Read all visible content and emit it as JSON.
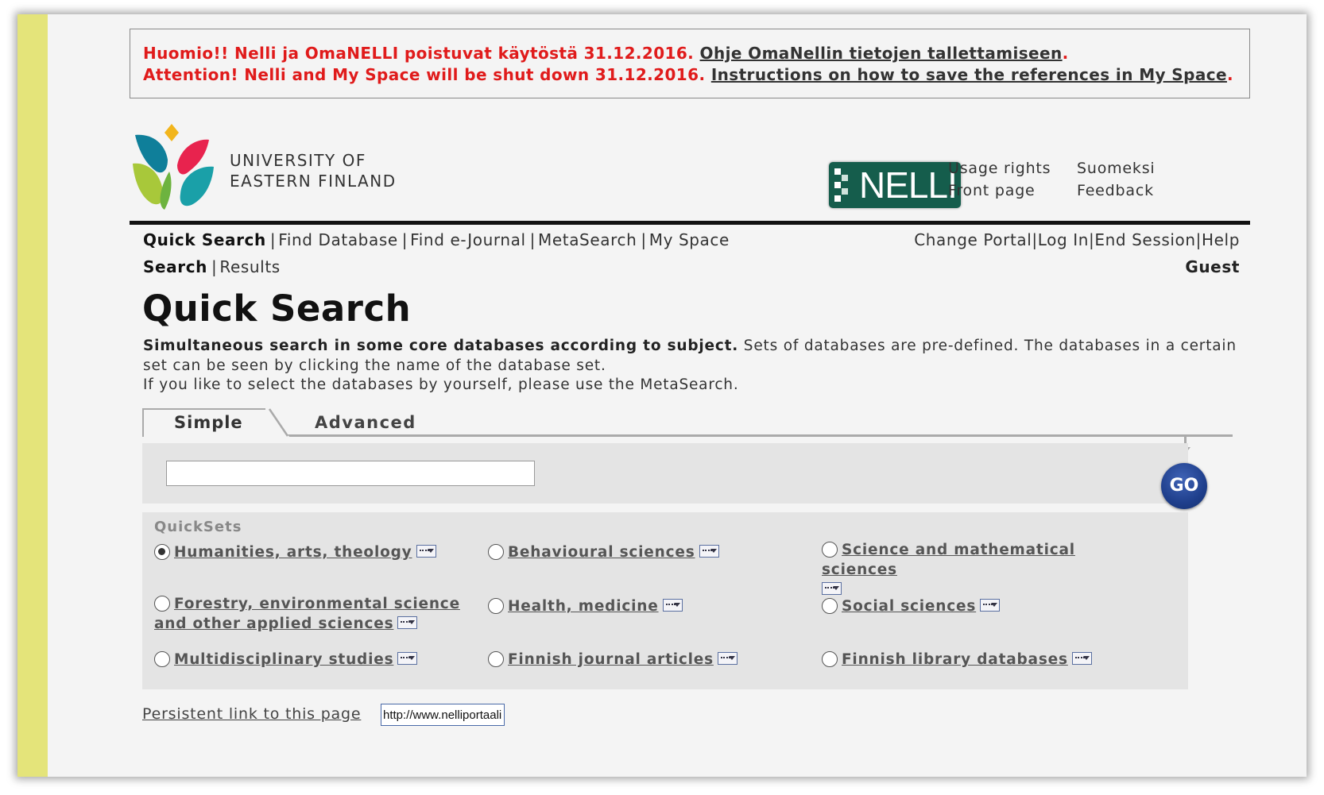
{
  "notice": {
    "line1_text": "Huomio!! Nelli ja OmaNELLI poistuvat käytöstä 31.12.2016. ",
    "line1_link": "Ohje OmaNellin tietojen tallettamiseen",
    "line1_end": ".",
    "line2_text": "Attention! Nelli and My Space will be shut down 31.12.2016. ",
    "line2_link": "Instructions on how to save the references in My Space",
    "line2_end": "."
  },
  "header": {
    "university_line1": "UNIVERSITY OF",
    "university_line2": "EASTERN FINLAND",
    "nelli_logo_text": "NELLI",
    "links_col1": [
      "Usage rights",
      "Front page"
    ],
    "links_col2": [
      "Suomeksi",
      "Feedback"
    ]
  },
  "nav": {
    "primary": [
      "Quick Search",
      "Find Database",
      "Find e-Journal",
      "MetaSearch",
      "My Space"
    ],
    "secondary": [
      "Search",
      "Results"
    ],
    "right": [
      "Change Portal",
      "Log In",
      "End Session",
      "Help"
    ],
    "user": "Guest"
  },
  "page": {
    "title": "Quick Search",
    "desc_bold": "Simultaneous search in some core databases according to subject.",
    "desc_rest": " Sets of databases are pre-defined. The databases in a certain set can be seen by clicking the name of the database set.",
    "desc_line2": "If you like to select the databases by yourself, please use the MetaSearch."
  },
  "tabs": {
    "simple": "Simple",
    "advanced": "Advanced"
  },
  "search": {
    "query_value": "",
    "go_label": "GO"
  },
  "quicksets": {
    "label": "QuickSets",
    "items": [
      {
        "label": "Humanities, arts, theology",
        "checked": true
      },
      {
        "label": "Behavioural sciences",
        "checked": false
      },
      {
        "label": "Science and mathematical sciences",
        "checked": false
      },
      {
        "label": "Forestry, environmental science and other applied sciences",
        "checked": false
      },
      {
        "label": "Health, medicine",
        "checked": false
      },
      {
        "label": "Social sciences",
        "checked": false
      },
      {
        "label": "Multidisciplinary studies",
        "checked": false
      },
      {
        "label": "Finnish journal articles",
        "checked": false
      },
      {
        "label": "Finnish library databases",
        "checked": false
      }
    ]
  },
  "persistent_link": {
    "label": "Persistent link to this page",
    "value": "http://www.nelliportaali.fi"
  },
  "colors": {
    "notice_red": "#e01b1b",
    "nelli_green": "#155d4c",
    "go_blue": "#1f3f8c",
    "side_yellow": "#e4e47a"
  }
}
